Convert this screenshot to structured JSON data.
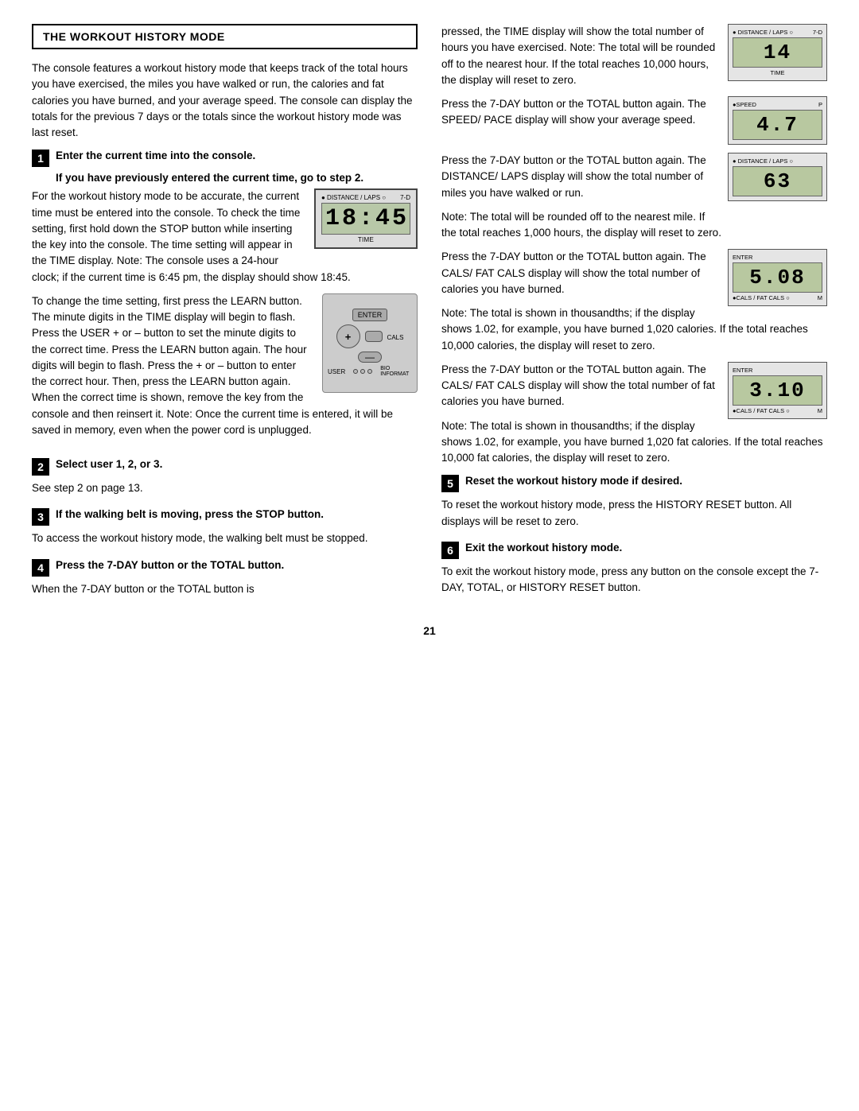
{
  "header": {
    "title": "THE WORKOUT HISTORY MODE"
  },
  "left": {
    "intro": "The console features a workout history mode that keeps track of the total hours you have exercised, the miles you have walked or run, the calories and fat calories you have burned, and your average speed. The console can display the totals for the previous 7 days or the totals since the workout history mode was last reset.",
    "steps": [
      {
        "num": "1",
        "title": "Enter the current time into the console.",
        "subtitle": "If you have previously entered the current time, go to step 2.",
        "body": "For the workout history mode to be accurate, the current time must be entered into the console. To check the time setting, first hold down the STOP button while inserting the key into the console. The time setting will appear in the TIME display. Note: The console uses a 24-hour clock; if the current time is 6:45 pm, the display should show 18:45.",
        "body2": "To change the time setting, first press the LEARN button. The minute digits in the TIME display will begin to flash. Press the USER + or – button to set the minute digits to the correct time. Press the LEARN button again. The hour digits will begin to flash. Press the + or – button to enter the correct hour. Then, press the LEARN button again. When the correct time is shown, remove the key from the console and then reinsert it. Note: Once the current time is entered, it will be saved in memory, even when the power cord is unplugged.",
        "display1": {
          "top_left": "● DISTANCE / LAPS ○",
          "top_right": "7-D",
          "value": "18:45",
          "bottom": "TIME"
        }
      },
      {
        "num": "2",
        "title": "Select user 1, 2, or 3.",
        "body": "See step 2 on page 13."
      },
      {
        "num": "3",
        "title": "If the walking belt is moving, press the STOP button.",
        "body": "To access the workout history mode, the walking belt must be stopped."
      },
      {
        "num": "4",
        "title": "Press the 7-DAY button or the TOTAL button.",
        "body": "When the 7-DAY button or the TOTAL button is"
      }
    ]
  },
  "right": {
    "continued_text": "pressed, the TIME display will show the total number of hours you have exercised. Note: The total will be rounded off to the nearest hour. If the total reaches 10,000 hours, the display will reset to zero.",
    "display_time": {
      "top_left": "● DISTANCE / LAPS ○",
      "top_right": "7-D",
      "value": "14",
      "bottom": "TIME"
    },
    "press_speed_text": "Press the 7-DAY button or the TOTAL button again. The SPEED/ PACE display will show your average speed.",
    "display_speed": {
      "top_left": "●SPEED",
      "top_right": "P",
      "value": "4.7"
    },
    "press_distance_text": "Press the 7-DAY button or the TOTAL button again. The DISTANCE/ LAPS display will show the total number of miles you have walked or run.",
    "press_distance_note": "Note: The total will be rounded off to the nearest mile. If the total reaches 1,000 hours, the display will reset to zero.",
    "display_distance": {
      "top_left": "● DISTANCE / LAPS ○",
      "value": "63"
    },
    "press_cals_text": "Press the 7-DAY button or the TOTAL button again. The CALS/ FAT CALS display will show the total number of calories you have burned.",
    "press_cals_note": "Note: The total is shown in thousandths; if the display shows 1.02, for example, you have burned 1,020 calories. If the total reaches 10,000 calories, the display will reset to zero.",
    "display_cals": {
      "top_left": "ENTER",
      "value": "5.08",
      "bottom_left": "●CALS / FAT CALS ○",
      "bottom_right": "M"
    },
    "press_fatcals_text": "Press the 7-DAY button or the TOTAL button again. The CALS/ FAT CALS display will show the total number of fat calories you have burned.",
    "press_fatcals_note": "Note: The total is shown in thousandths; if the display shows 1.02, for example, you have burned 1,020 fat calories. If the total reaches 10,000 fat calories, the display will reset to zero.",
    "display_fatcals": {
      "top_left": "ENTER",
      "value": "3.10",
      "bottom_left": "●CALS / FAT CALS ○",
      "bottom_right": "M"
    },
    "steps": [
      {
        "num": "5",
        "title": "Reset the workout history mode if desired.",
        "body": "To reset the workout history mode, press the HISTORY RESET button. All displays will be reset to zero."
      },
      {
        "num": "6",
        "title": "Exit the workout history mode.",
        "body": "To exit the workout history mode, press any button on the console except the 7-DAY, TOTAL, or HISTORY RESET button."
      }
    ]
  },
  "page_number": "21"
}
